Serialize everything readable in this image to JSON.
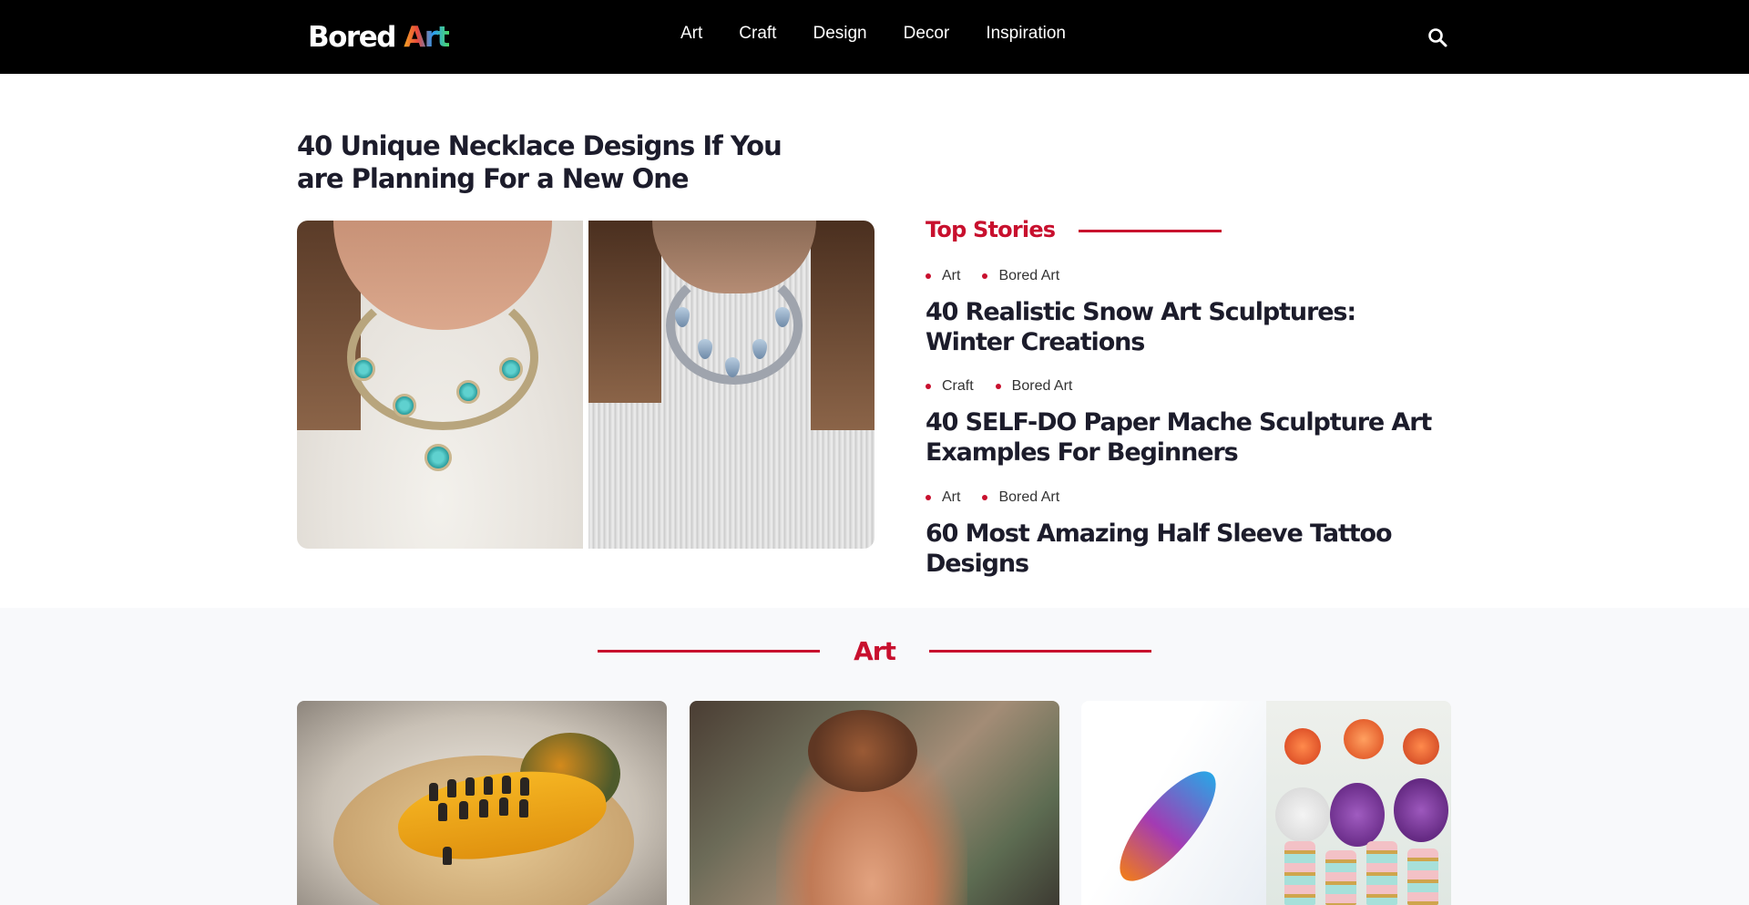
{
  "site": {
    "logo_main": "Bored ",
    "logo_accent": "Art"
  },
  "nav": {
    "items": [
      "Art",
      "Craft",
      "Design",
      "Decor",
      "Inspiration"
    ],
    "search_icon": "search-icon"
  },
  "hero": {
    "title": "40 Unique Necklace Designs If You are Planning For a New One",
    "image": "necklace-photo"
  },
  "top_stories": {
    "heading": "Top Stories",
    "stories": [
      {
        "category": "Art",
        "author": "Bored Art",
        "title": "40 Realistic Snow Art Sculptures: Winter Creations"
      },
      {
        "category": "Craft",
        "author": "Bored Art",
        "title": "40 SELF-DO Paper Mache Sculpture Art Examples For Beginners"
      },
      {
        "category": "Art",
        "author": "Bored Art",
        "title": "60 Most Amazing Half Sleeve Tattoo Designs"
      }
    ]
  },
  "art_section": {
    "heading": "Art",
    "cards": [
      {
        "image": "pumpkin-miniature-photo"
      },
      {
        "image": "painting-photo"
      },
      {
        "image": "feather-and-vases-photo"
      }
    ]
  },
  "colors": {
    "accent": "#c8102e",
    "header_bg": "#000000",
    "section_bg": "#f8f9fb"
  }
}
